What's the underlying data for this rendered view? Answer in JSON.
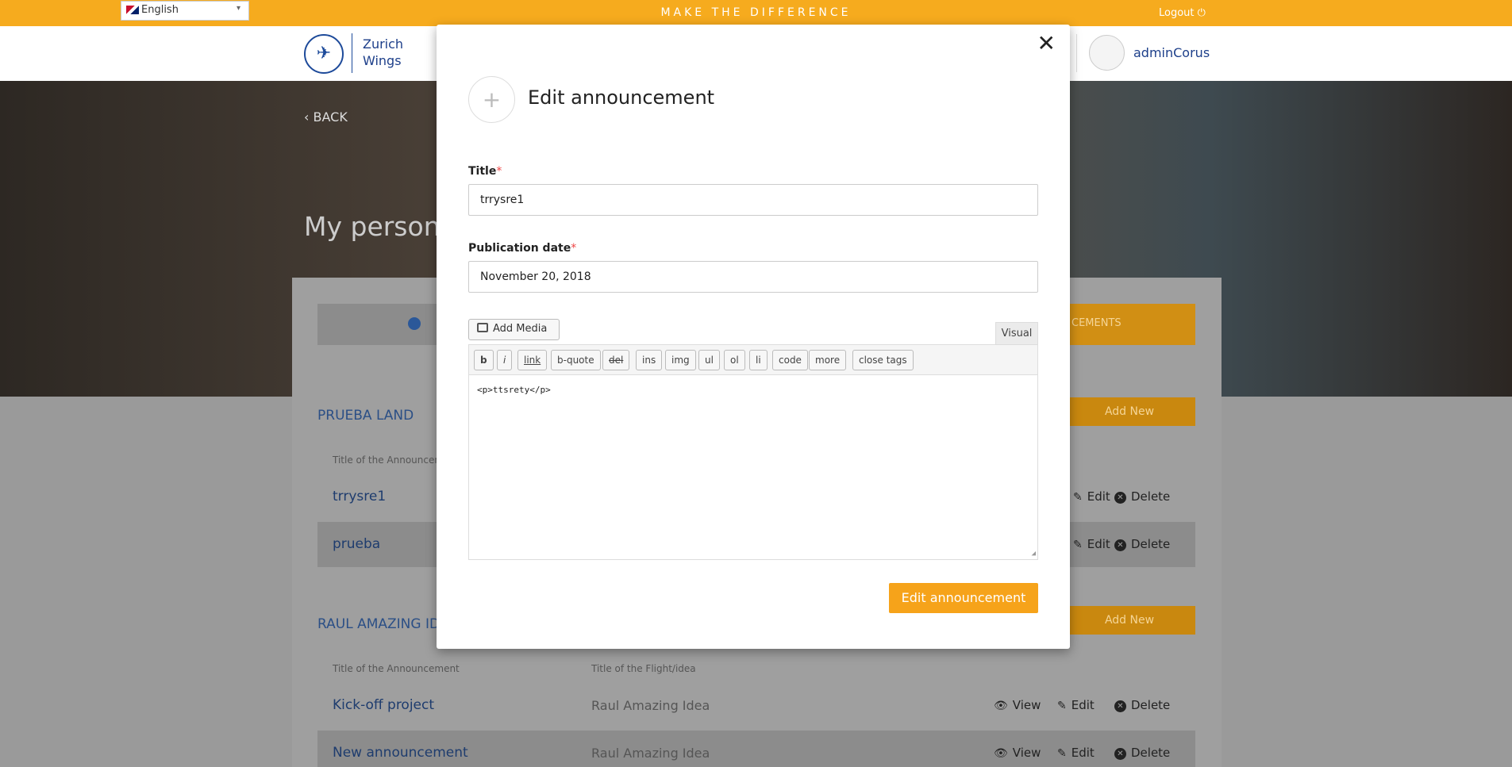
{
  "topbar": {
    "language": "English",
    "tagline": "MAKE THE DIFFERENCE",
    "logout": "Logout"
  },
  "header": {
    "logo_line1": "Zurich",
    "logo_line2": "Wings",
    "username": "adminCorus"
  },
  "hero": {
    "back": "BACK",
    "title": "My persona"
  },
  "tabs": {
    "active_partial": "CEMENTS"
  },
  "groups": [
    {
      "title": "PRUEBA LAND",
      "add_new": "Add New",
      "col_title": "Title of the Announcem",
      "rows": [
        {
          "title": "trrysre1",
          "flight": "",
          "edit": "Edit",
          "delete": "Delete"
        },
        {
          "title": "prueba",
          "flight": "",
          "edit": "Edit",
          "delete": "Delete"
        }
      ]
    },
    {
      "title": "RAUL AMAZING IDE",
      "add_new": "Add New",
      "col_title": "Title of the Announcement",
      "col_flight": "Title of the Flight/idea",
      "rows": [
        {
          "title": "Kick-off project",
          "flight": "Raul Amazing Idea",
          "view": "View",
          "edit": "Edit",
          "delete": "Delete"
        },
        {
          "title": "New announcement",
          "flight": "Raul Amazing Idea",
          "view": "View",
          "edit": "Edit",
          "delete": "Delete"
        }
      ]
    }
  ],
  "modal": {
    "title": "Edit announcement",
    "title_label": "Title",
    "title_value": "trrysre1",
    "date_label": "Publication date",
    "date_value": "November 20, 2018",
    "required_mark": "*",
    "add_media": "Add Media",
    "visual_tab": "Visual",
    "quicktags": [
      "b",
      "i",
      "link",
      "b-quote",
      "del",
      "ins",
      "img",
      "ul",
      "ol",
      "li",
      "code",
      "more",
      "close tags"
    ],
    "content": "<p>ttsrety</p>",
    "submit": "Edit announcement"
  },
  "colors": {
    "accent": "#f6ab1e",
    "brand_blue": "#1d3f8a",
    "submit": "#f6a31a"
  }
}
